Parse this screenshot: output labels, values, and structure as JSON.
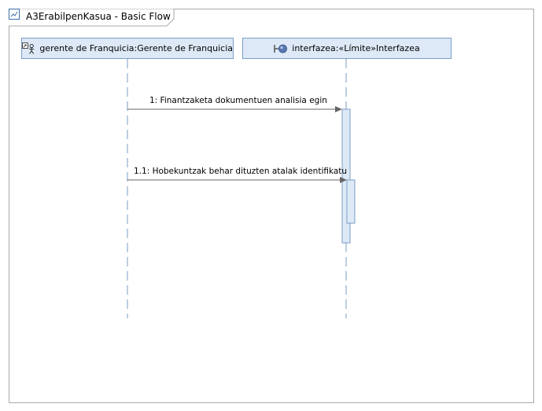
{
  "frame": {
    "title": "A3ErabilpenKasua - Basic Flow"
  },
  "lifelines": [
    {
      "label": "gerente de Franquicia:Gerente de Franquicia",
      "icon": "actor-icon"
    },
    {
      "label": "interfazea:«Límite»Interfazea",
      "icon": "boundary-icon"
    }
  ],
  "messages": [
    {
      "label": "1: Finantzaketa dokumentuen analisia egin"
    },
    {
      "label": "1.1: Hobekuntzak behar dituzten atalak identifikatu"
    }
  ],
  "colors": {
    "lifeline_fill": "#dde9f6",
    "lifeline_border": "#7a9ec4",
    "activation_fill": "#dde9f6",
    "frame_border": "#a9a9a9",
    "message_line": "#666666"
  }
}
